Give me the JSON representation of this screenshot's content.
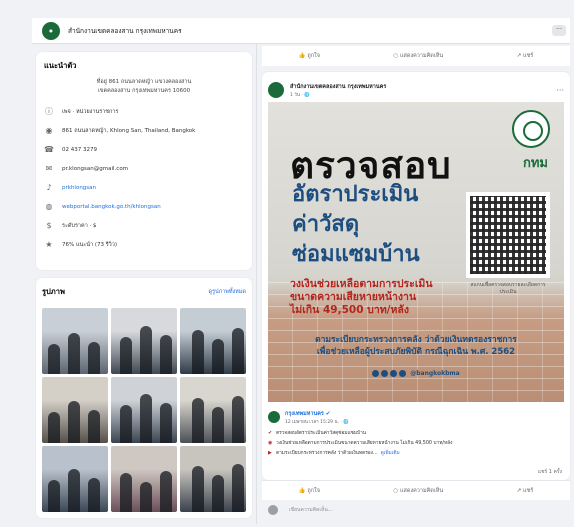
{
  "header": {
    "page_name": "สำนักงานเขตคลองสาน กรุงเทพมหานคร",
    "more": "···"
  },
  "intro": {
    "title": "แนะนำตัว",
    "bio": "ที่อยู่ 861 ถนนลาดหญ้า แขวงคลองสาน\nเขตคลองสาน กรุงเทพมหานคร 10600",
    "items": [
      {
        "icon": "info-icon",
        "text": "เพจ · หน่วยงานราชการ"
      },
      {
        "icon": "location-icon",
        "text": "861 ถนนลาดหญ้า, Khlong San, Thailand, Bangkok"
      },
      {
        "icon": "phone-icon",
        "text": "02 437 3279"
      },
      {
        "icon": "email-icon",
        "text": "pr.klongsan@gmail.com"
      },
      {
        "icon": "tiktok-icon",
        "text": "prkhlongsan",
        "link": true
      },
      {
        "icon": "globe-icon",
        "text": "webportal.bangkok.go.th/khlongsan",
        "link": true
      },
      {
        "icon": "price-icon",
        "text": "ระดับราคา · $"
      },
      {
        "icon": "star-icon",
        "text": "76% แนะนำ (73 รีวิว)"
      }
    ]
  },
  "photos": {
    "title": "รูปภาพ",
    "see_all": "ดูรูปภาพทั้งหมด",
    "tiles": [
      {
        "c1": "#c9cfd6",
        "c2": "#5b6470"
      },
      {
        "c1": "#d7d9dc",
        "c2": "#3e4752"
      },
      {
        "c1": "#c4ccd4",
        "c2": "#2f3a46"
      },
      {
        "c1": "#d4d0c8",
        "c2": "#55504a"
      },
      {
        "c1": "#cfd3d8",
        "c2": "#3a4350"
      },
      {
        "c1": "#d9d6cf",
        "c2": "#4b4f57"
      },
      {
        "c1": "#b9c2cc",
        "c2": "#3b4654"
      },
      {
        "c1": "#cfc7c2",
        "c2": "#6a4f58"
      },
      {
        "c1": "#c8c5bf",
        "c2": "#39414b"
      }
    ]
  },
  "post_actions": {
    "like": "ถูกใจ",
    "comment": "แสดงความคิดเห็น",
    "share": "แชร์"
  },
  "post": {
    "page_name": "สำนักงานเขตคลองสาน กรุงเทพมหานคร",
    "time": "1 วัน · 🌐",
    "menu": "···",
    "banner": {
      "title": "ตรวจสอบ",
      "subtitle_lines": [
        "อัตราประเมิน",
        "ค่าวัสดุ",
        "ซ่อมแซมบ้าน"
      ],
      "seal_label": "กทม",
      "qr_caption": "สแกนเพื่อตรวจสอบรายละเอียดการประเมิน",
      "red_lines": [
        "วงเงินช่วยเหลือตามการประเมิน",
        "ขนาดความเสียหายหน้างาน",
        "ไม่เกิน 49,500 บาท/หลัง"
      ],
      "bottom_lines": [
        "ตามระเบียบกระทรวงการคลัง ว่าด้วยเงินทดรองราชการ",
        "เพื่อช่วยเหลือผู้ประสบภัยพิบัติ กรณีฉุกเฉิน พ.ศ. 2562"
      ],
      "social": "@bangkokbma"
    },
    "comment": {
      "name": "กรุงเทพมหานคร ✔",
      "date": "12 เมษายน เวลา 15:29 น. · 🌐",
      "lines": [
        {
          "icon": "✔",
          "text": "ตรวจสอบอัตราประเมินค่าวัสดุซ่อมแซมบ้าน"
        },
        {
          "icon": "◉",
          "text": "วงเงินช่วยเหลือตามการประเมินขนาดความเสียหายหน้างาน ไม่เกิน 49,500 บาท/หลัง"
        },
        {
          "icon": "▶",
          "text": "ตามระเบียบกระทรวงการคลัง ว่าด้วยเงินทดรอง...",
          "more": "ดูเพิ่มเติม"
        }
      ]
    },
    "share_count": "แชร์ 1 ครั้ง",
    "comment_placeholder": "เขียนความคิดเห็น..."
  }
}
